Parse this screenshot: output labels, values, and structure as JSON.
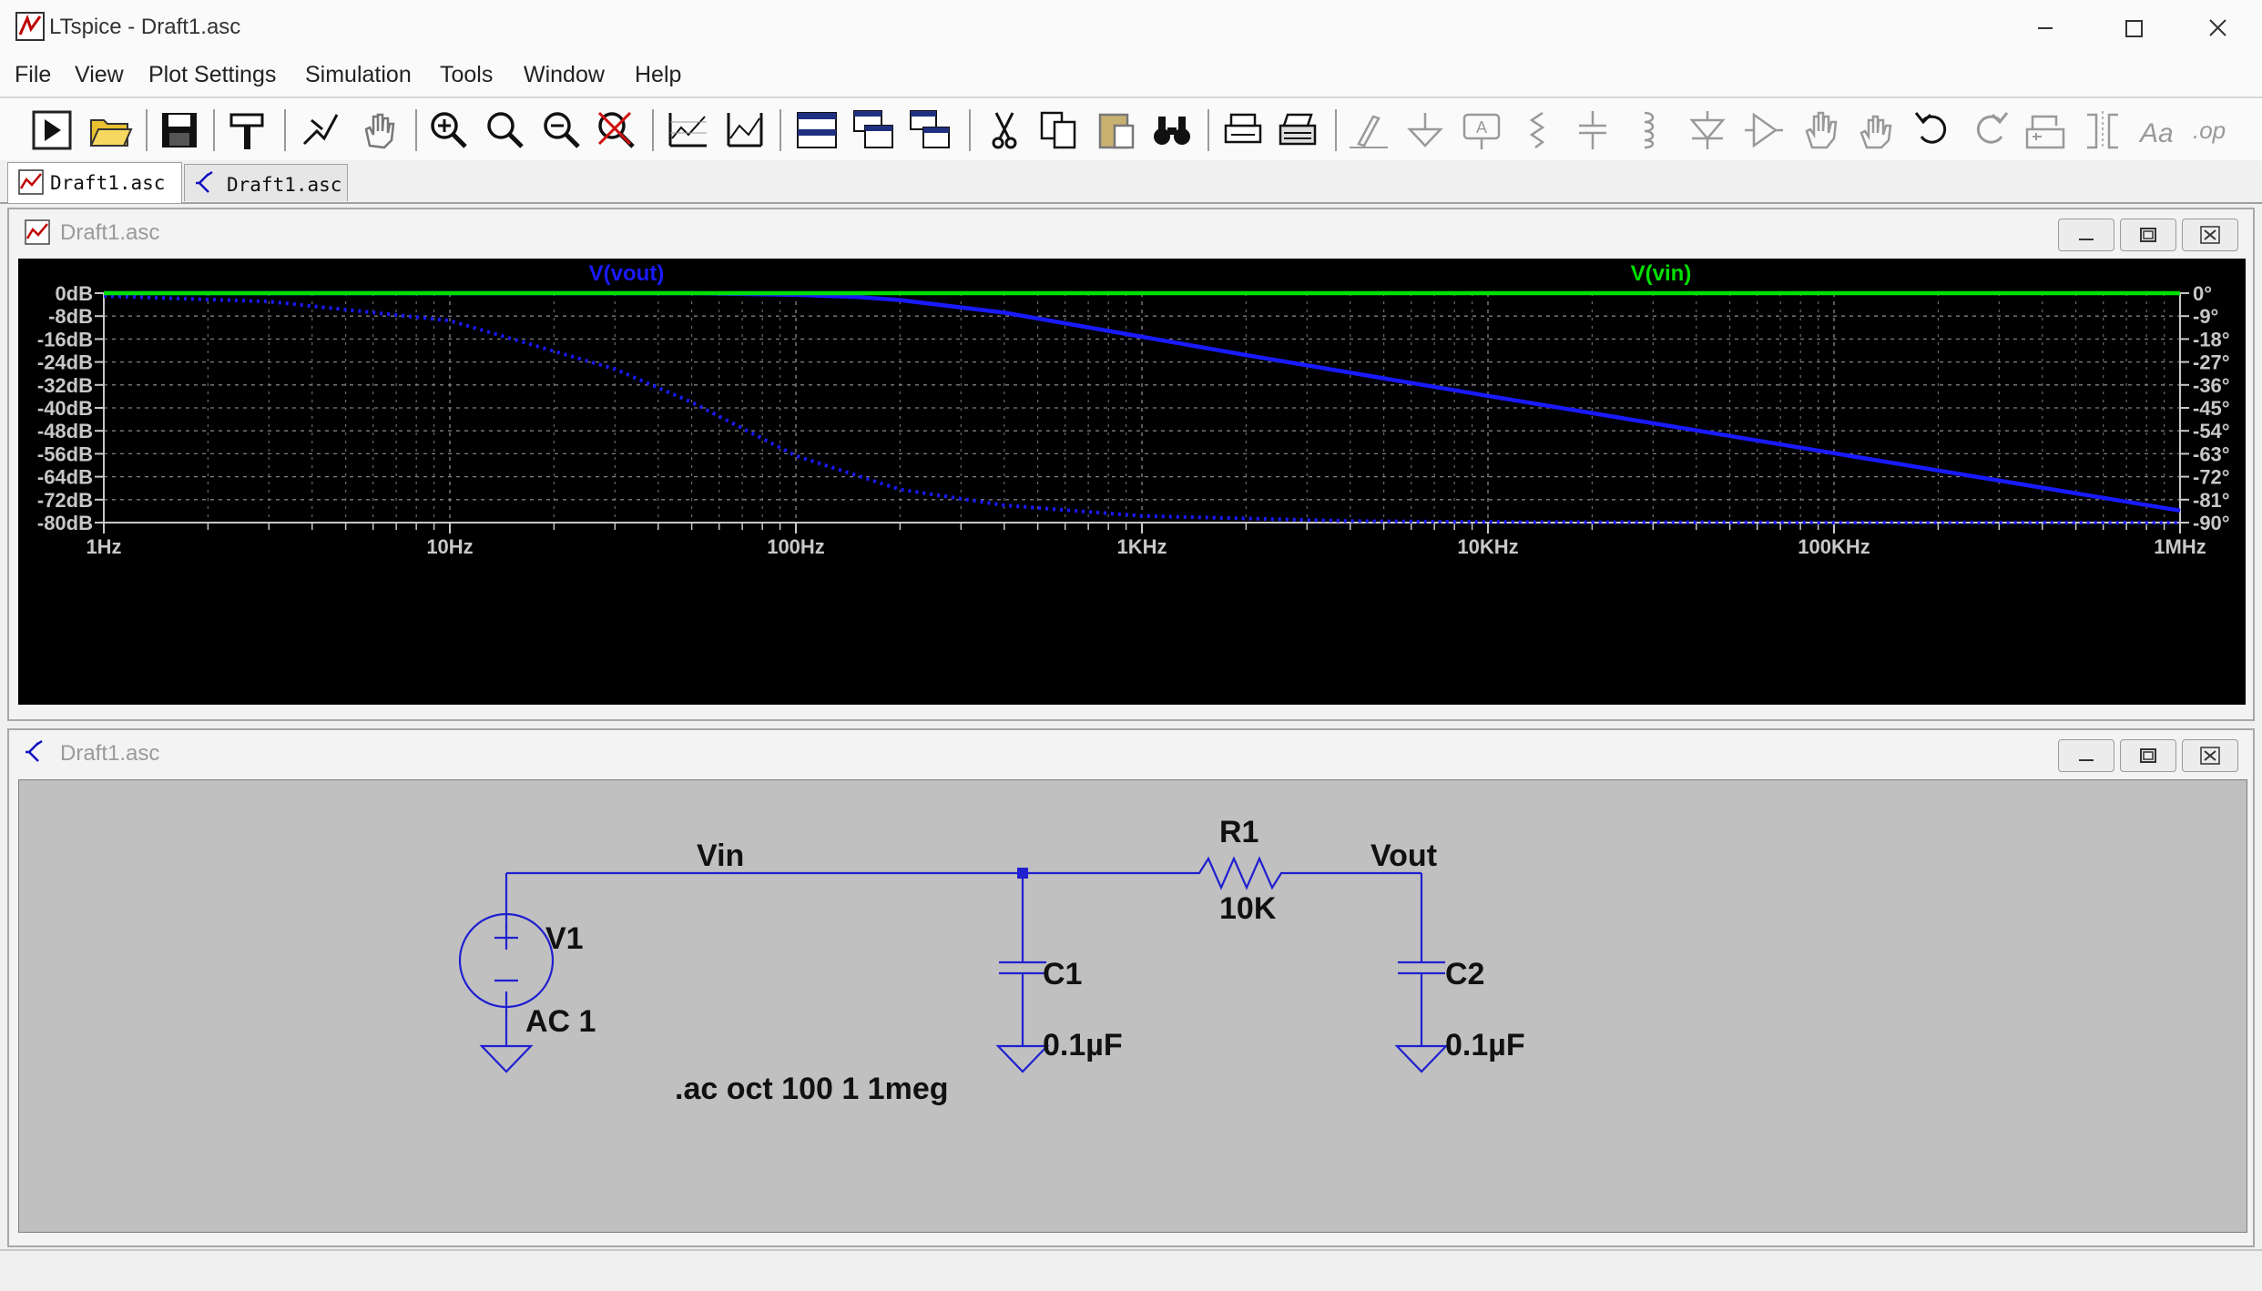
{
  "window": {
    "title": "LTspice - Draft1.asc"
  },
  "menu": [
    "File",
    "View",
    "Plot Settings",
    "Simulation",
    "Tools",
    "Window",
    "Help"
  ],
  "toolbar_icons": [
    "run-icon",
    "open-icon",
    "save-icon",
    "hammer-icon",
    "probe-icon",
    "pan-hand-icon",
    "zoom-in-icon",
    "zoom-area-icon",
    "zoom-out-icon",
    "zoom-cancel-icon",
    "plot-autoscale-icon",
    "plot-settings-icon",
    "tile-horizontal-icon",
    "cascade-icon",
    "cascade-alt-icon",
    "cut-icon",
    "copy-icon",
    "paste-icon",
    "find-icon",
    "print-preview-icon",
    "print-icon",
    "wire-icon",
    "ground-icon",
    "label-net-icon",
    "resistor-icon",
    "capacitor-icon",
    "inductor-icon",
    "diode-icon",
    "component-icon",
    "move-icon",
    "drag-icon",
    "undo-icon",
    "redo-icon",
    "rotate-icon",
    "mirror-icon",
    "text-icon",
    "spice-directive-icon"
  ],
  "tabs": [
    {
      "label": "Draft1.asc",
      "icon": "waveform-icon",
      "active": true
    },
    {
      "label": "Draft1.asc",
      "icon": "schematic-icon",
      "active": false
    }
  ],
  "plot_window": {
    "title": "Draft1.asc"
  },
  "schematic_window": {
    "title": "Draft1.asc"
  },
  "colors": {
    "trace_vout": "#1a1aff",
    "trace_vin": "#00e000",
    "plot_bg": "#000000",
    "wire": "#2020d0",
    "schematic_bg": "#c0c0c0"
  },
  "chart_data": {
    "type": "line",
    "x_scale": "log",
    "xlim": [
      1,
      1000000
    ],
    "x_ticks": [
      "1Hz",
      "10Hz",
      "100Hz",
      "1KHz",
      "10KHz",
      "100KHz",
      "1MHz"
    ],
    "y_ticks_left": [
      "0dB",
      "-8dB",
      "-16dB",
      "-24dB",
      "-32dB",
      "-40dB",
      "-48dB",
      "-56dB",
      "-64dB",
      "-72dB",
      "-80dB"
    ],
    "y_ticks_right": [
      "0°",
      "-9°",
      "-18°",
      "-27°",
      "-36°",
      "-45°",
      "-54°",
      "-63°",
      "-72°",
      "-81°",
      "-90°"
    ],
    "ylim_left": [
      -80,
      0
    ],
    "ylim_right": [
      -90,
      0
    ],
    "grid": true,
    "series": [
      {
        "name": "V(vout)",
        "style": "solid",
        "axis": "left",
        "x": [
          1,
          10,
          50,
          100,
          150,
          200,
          400,
          1000,
          2000,
          10000,
          100000,
          1000000
        ],
        "y": [
          0,
          0,
          0,
          -0.6,
          -1.3,
          -2.4,
          -6.8,
          -15.2,
          -21.6,
          -35.8,
          -55.8,
          -75.8
        ]
      },
      {
        "name": "V(vout)",
        "style": "dotted",
        "axis": "right",
        "x": [
          1,
          3,
          10,
          30,
          50,
          100,
          200,
          400,
          1000,
          4000,
          10000,
          100000,
          1000000
        ],
        "y": [
          -1.1,
          -3.3,
          -10.8,
          -29.8,
          -42.8,
          -63.8,
          -77.0,
          -83.2,
          -87.4,
          -89.4,
          -89.8,
          -90,
          -90
        ]
      },
      {
        "name": "V(vin)",
        "style": "solid",
        "axis": "left",
        "x": [
          1,
          1000000
        ],
        "y": [
          0,
          0
        ]
      },
      {
        "name": "V(vin)",
        "style": "dotted",
        "axis": "right",
        "x": [
          1,
          1000000
        ],
        "y": [
          0,
          0
        ]
      }
    ]
  },
  "schematic": {
    "labels": {
      "vin": "Vin",
      "vout": "Vout",
      "v1_name": "V1",
      "v1_value": "AC 1",
      "r1_name": "R1",
      "r1_value": "10K",
      "c1_name": "C1",
      "c1_value": "0.1µF",
      "c2_name": "C2",
      "c2_value": "0.1µF",
      "directive": ".ac oct 100 1 1meg"
    }
  }
}
